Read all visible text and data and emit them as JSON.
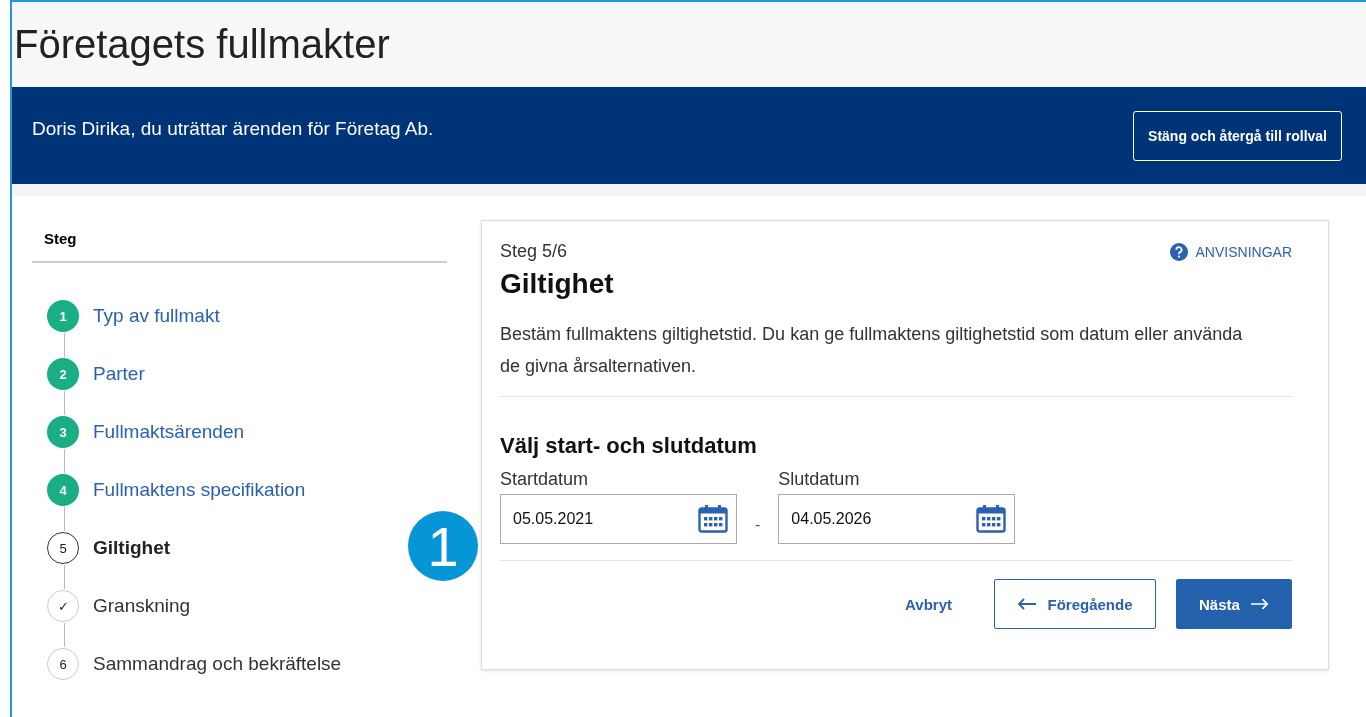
{
  "page_title": "Företagets fullmakter",
  "banner": {
    "text": "Doris Dirika, du uträttar ärenden för Företag Ab.",
    "button": "Stäng och återgå till rollval"
  },
  "steps": {
    "heading": "Steg",
    "items": [
      {
        "marker": "1",
        "label": "Typ av fullmakt",
        "completed": true,
        "selected": false
      },
      {
        "marker": "2",
        "label": "Parter",
        "completed": true,
        "selected": false
      },
      {
        "marker": "3",
        "label": "Fullmaktsärenden",
        "completed": true,
        "selected": false
      },
      {
        "marker": "4",
        "label": "Fullmaktens specifikation",
        "completed": true,
        "selected": false
      },
      {
        "marker": "5",
        "label": "Giltighet",
        "completed": false,
        "selected": true
      },
      {
        "marker": "✓",
        "label": "Granskning",
        "completed": false,
        "selected": false
      },
      {
        "marker": "6",
        "label": "Sammandrag och bekräftelse",
        "completed": false,
        "selected": false
      }
    ]
  },
  "form": {
    "step": "Steg 5/6",
    "help": "ANVISNINGAR",
    "title": "Giltighet",
    "description": "Bestäm fullmaktens giltighetstid. Du kan ge fullmaktens giltighetstid som datum eller använda de givna årsalternativen.",
    "subtitle": "Välj start- och slutdatum",
    "fields": [
      {
        "label": "Startdatum",
        "value": "05.05.2021"
      },
      {
        "label": "Slutdatum",
        "value": "04.05.2026"
      }
    ],
    "separator": "-",
    "cancel": "Avbryt",
    "previous": "Föregående",
    "next": "Nästa"
  },
  "callout": {
    "label": "1"
  }
}
